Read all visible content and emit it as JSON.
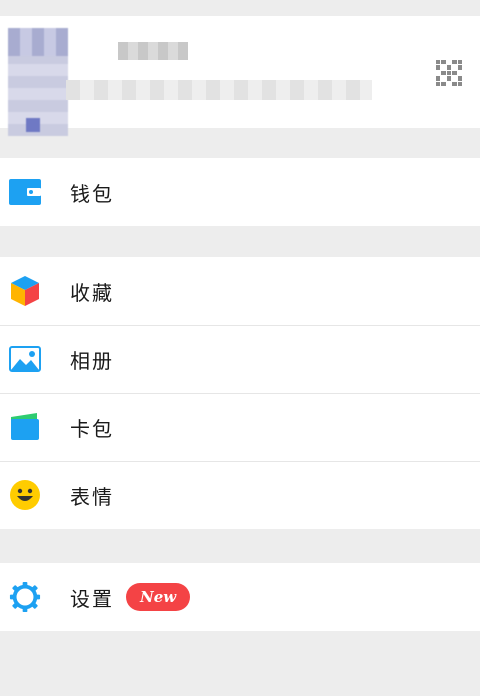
{
  "menu": {
    "wallet": {
      "label": "钱包",
      "icon": "wallet-icon"
    },
    "favorites": {
      "label": "收藏",
      "icon": "cube-icon"
    },
    "album": {
      "label": "相册",
      "icon": "photo-icon"
    },
    "cards": {
      "label": "卡包",
      "icon": "card-icon"
    },
    "stickers": {
      "label": "表情",
      "icon": "smile-icon"
    },
    "settings": {
      "label": "设置",
      "icon": "gear-icon",
      "badge": "New"
    }
  },
  "colors": {
    "accent_blue": "#1da1f2",
    "badge_red": "#f44345",
    "smile_yellow": "#ffcc00",
    "background": "#ededed"
  }
}
